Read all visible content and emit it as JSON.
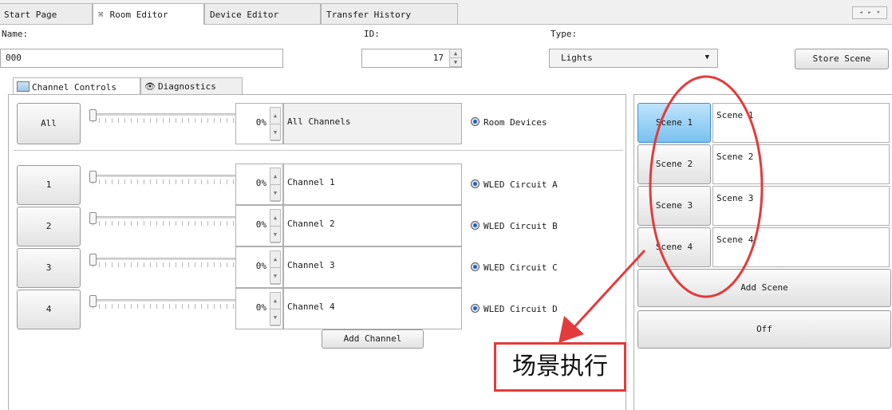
{
  "tabs": [
    {
      "label": "Start Page"
    },
    {
      "label": "Room Editor",
      "close": "⌘"
    },
    {
      "label": "Device Editor"
    },
    {
      "label": "Transfer History"
    }
  ],
  "scroll_label": "◂ ▸ ▾",
  "header": {
    "name_label": "Name:",
    "name_value": "000",
    "id_label": "ID:",
    "id_value": "17",
    "type_label": "Type:",
    "type_value": "Lights",
    "store_scene": "Store Scene"
  },
  "subtabs": {
    "channel_controls": "Channel Controls",
    "diagnostics": "Diagnostics"
  },
  "all_row": {
    "button": "All",
    "percent": "0%",
    "name": "All Channels",
    "radio": "Room Devices"
  },
  "channels": [
    {
      "button": "1",
      "percent": "0%",
      "name": "Channel 1",
      "radio": "WLED Circuit A"
    },
    {
      "button": "2",
      "percent": "0%",
      "name": "Channel 2",
      "radio": "WLED Circuit B"
    },
    {
      "button": "3",
      "percent": "0%",
      "name": "Channel 3",
      "radio": "WLED Circuit C"
    },
    {
      "button": "4",
      "percent": "0%",
      "name": "Channel 4",
      "radio": "WLED Circuit D"
    }
  ],
  "add_channel": "Add Channel",
  "scenes": [
    {
      "button": "Scene 1",
      "name": "Scene 1"
    },
    {
      "button": "Scene 2",
      "name": "Scene 2"
    },
    {
      "button": "Scene 3",
      "name": "Scene 3"
    },
    {
      "button": "Scene 4",
      "name": "Scene 4"
    }
  ],
  "add_scene": "Add Scene",
  "off": "Off",
  "annotation": {
    "text": "场景执行",
    "color": "#e33b3b"
  }
}
